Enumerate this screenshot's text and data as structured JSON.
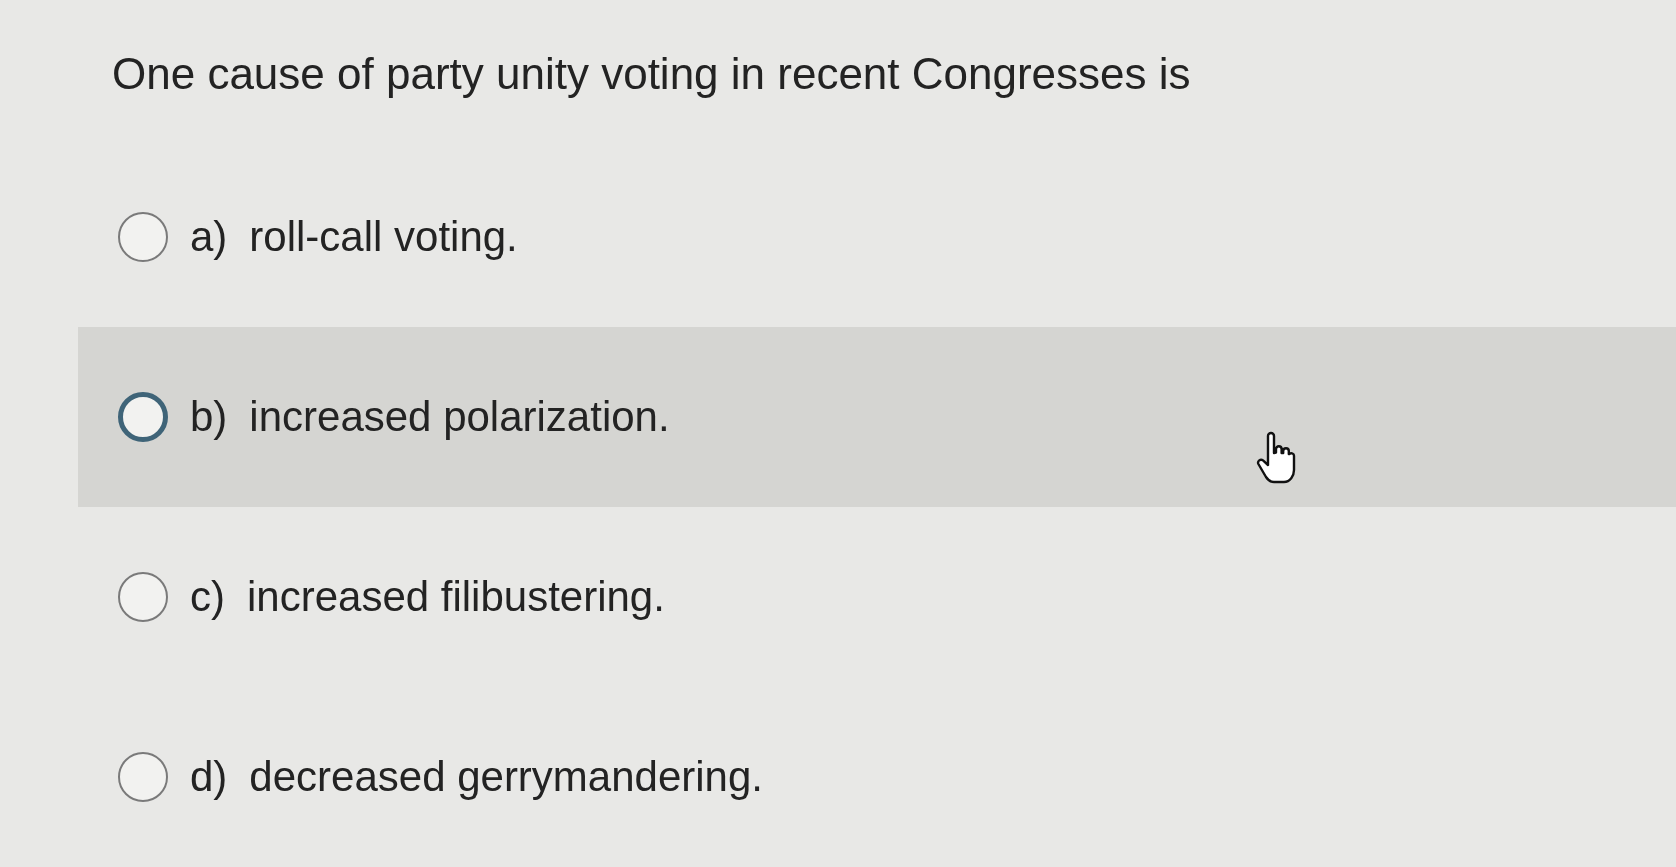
{
  "question": "One cause of party unity voting in recent Congresses is",
  "options": [
    {
      "letter": "a)",
      "text": "roll-call voting.",
      "selected": false,
      "hovered": false
    },
    {
      "letter": "b)",
      "text": "increased polarization.",
      "selected": false,
      "hovered": true
    },
    {
      "letter": "c)",
      "text": "increased filibustering.",
      "selected": false,
      "hovered": false
    },
    {
      "letter": "d)",
      "text": "decreased gerrymandering.",
      "selected": false,
      "hovered": false
    }
  ]
}
